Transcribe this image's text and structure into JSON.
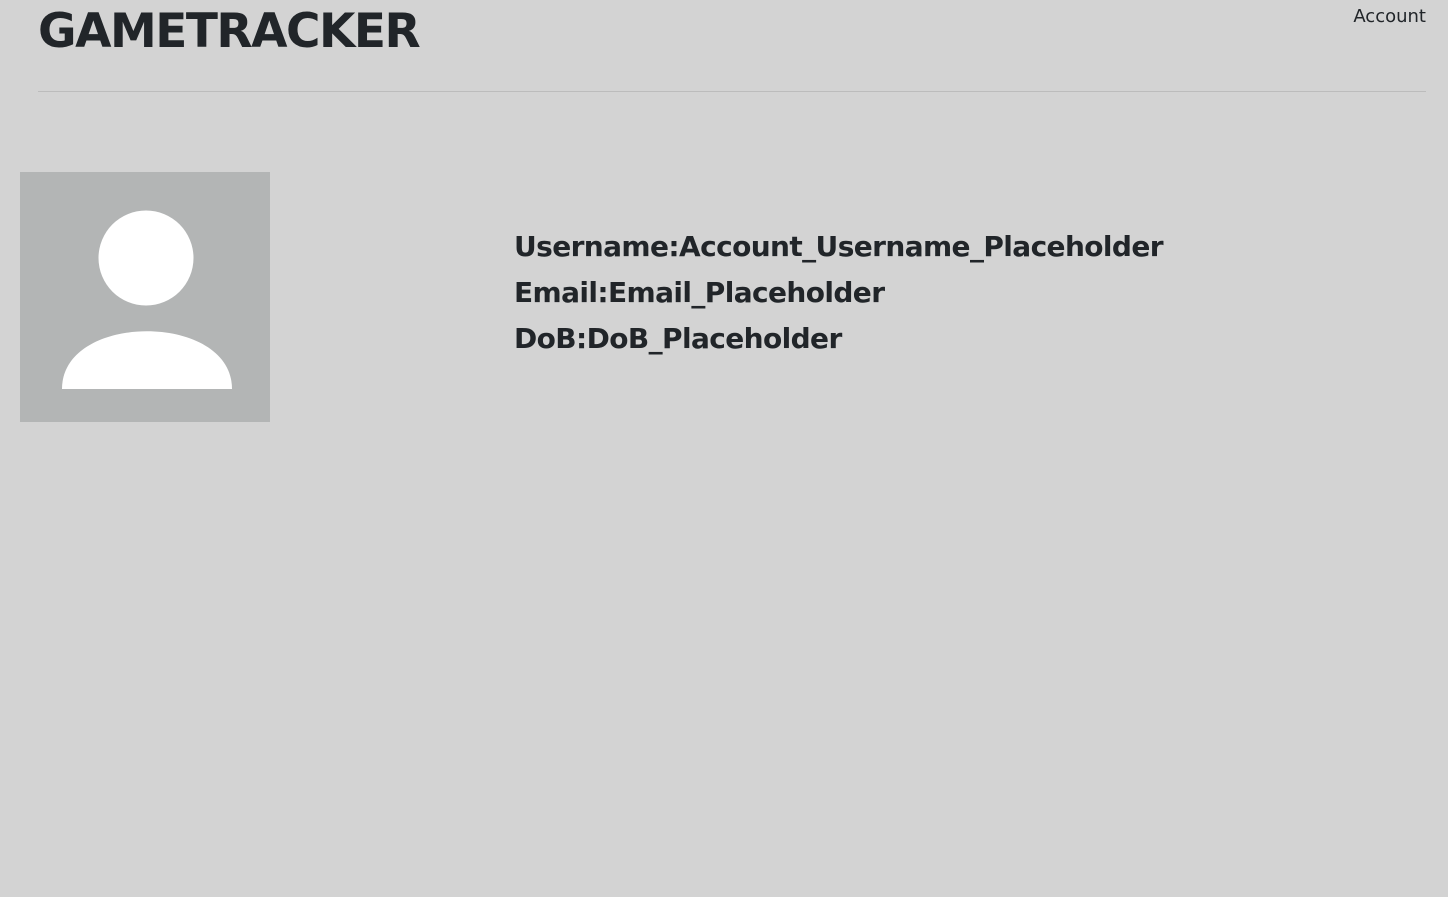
{
  "header": {
    "title": "GAMETRACKER",
    "account_link": "Account"
  },
  "profile": {
    "avatar_icon": "user-silhouette-icon",
    "username_label": "Username:",
    "username_value": "Account_Username_Placeholder",
    "email_label": "Email:",
    "email_value": "Email_Placeholder",
    "dob_label": "DoB:",
    "dob_value": "DoB_Placeholder"
  },
  "colors": {
    "background": "#d3d3d3",
    "avatar_background": "#b3b5b5",
    "avatar_figure": "#ffffff",
    "text": "#212529"
  }
}
